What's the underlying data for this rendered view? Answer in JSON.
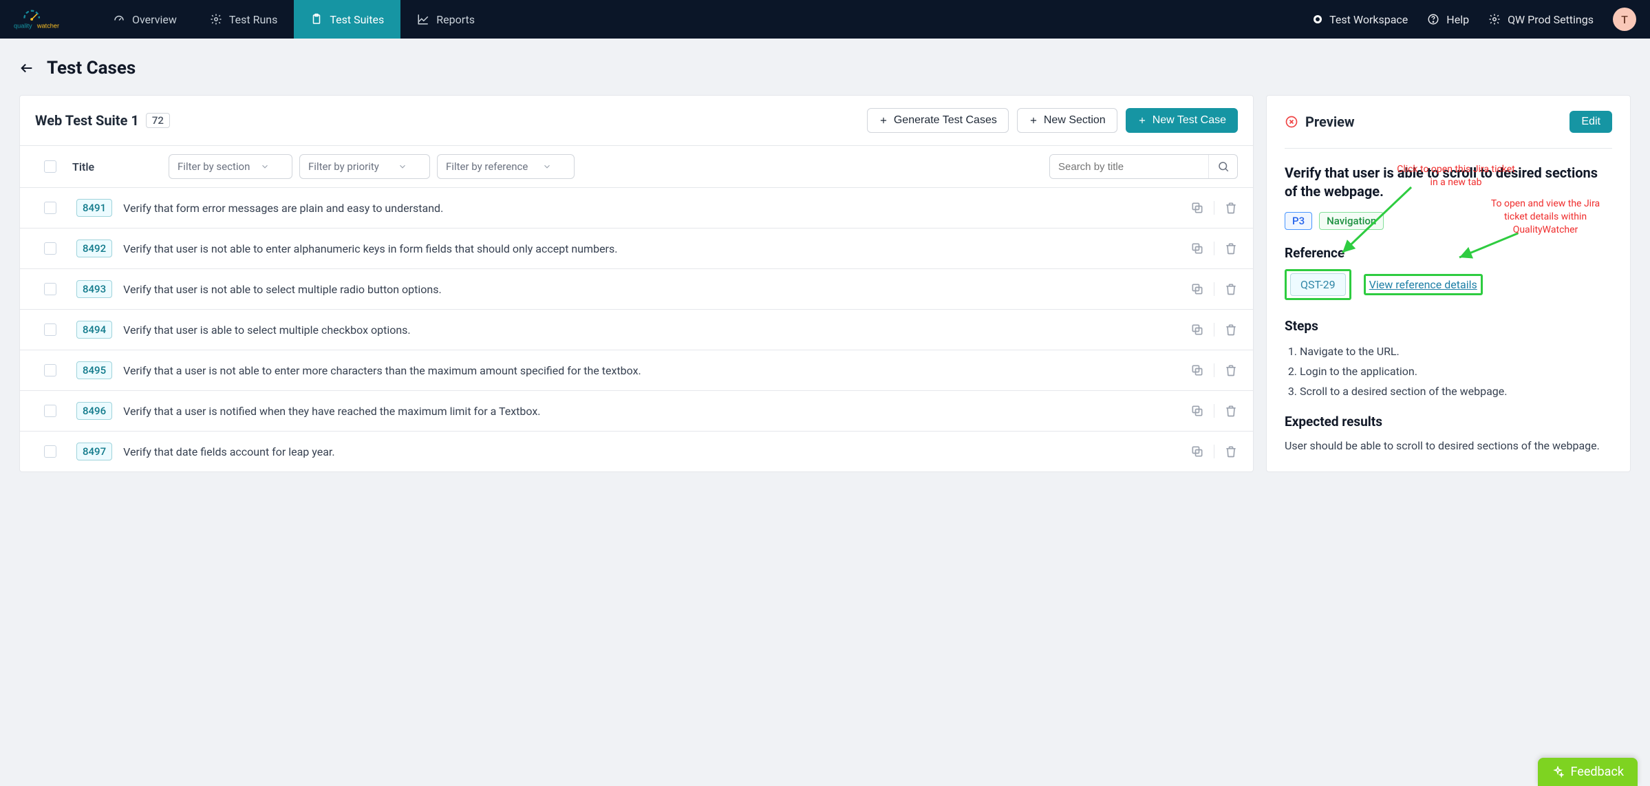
{
  "brand": "qualitywatcher",
  "nav": {
    "tabs": [
      {
        "label": "Overview"
      },
      {
        "label": "Test Runs"
      },
      {
        "label": "Test Suites"
      },
      {
        "label": "Reports"
      }
    ],
    "active_index": 2,
    "workspace": "Test Workspace",
    "help": "Help",
    "settings": "QW Prod Settings",
    "avatar_letter": "T"
  },
  "page": {
    "title": "Test Cases"
  },
  "suite": {
    "name": "Web Test Suite 1",
    "count": "72",
    "generate_label": "Generate Test Cases",
    "new_section_label": "New Section",
    "new_case_label": "New Test Case"
  },
  "filters": {
    "title_label": "Title",
    "section_placeholder": "Filter by section",
    "priority_placeholder": "Filter by priority",
    "reference_placeholder": "Filter by reference",
    "search_placeholder": "Search by title"
  },
  "test_cases": [
    {
      "id": "8491",
      "title": "Verify that form error messages are plain and easy to understand."
    },
    {
      "id": "8492",
      "title": "Verify that user is not able to enter alphanumeric keys in form fields that should only accept numbers."
    },
    {
      "id": "8493",
      "title": "Verify that user is not able to select multiple radio button options."
    },
    {
      "id": "8494",
      "title": "Verify that user is able to select multiple checkbox options."
    },
    {
      "id": "8495",
      "title": "Verify that a user is not able to enter more characters than the maximum amount specified for the textbox."
    },
    {
      "id": "8496",
      "title": "Verify that a user is notified when they have reached the maximum limit for a Textbox."
    },
    {
      "id": "8497",
      "title": "Verify that date fields account for leap year."
    }
  ],
  "preview": {
    "header": "Preview",
    "edit_label": "Edit",
    "title": "Verify that user is able to scroll to desired sections of the webpage.",
    "priority": "P3",
    "category": "Navigation",
    "reference_header": "Reference",
    "reference_id": "QST-29",
    "view_details_label": "View reference details",
    "steps_header": "Steps",
    "steps": [
      "Navigate to the URL.",
      "Login to the application.",
      "Scroll to a desired section of the webpage."
    ],
    "expected_header": "Expected results",
    "expected_body": "User should be able to scroll to desired sections of the webpage."
  },
  "annotations": {
    "jira_open": "Click to open this Jira ticket in a new tab",
    "jira_view": "To open and view the Jira ticket details within QualityWatcher"
  },
  "feedback_label": "Feedback"
}
